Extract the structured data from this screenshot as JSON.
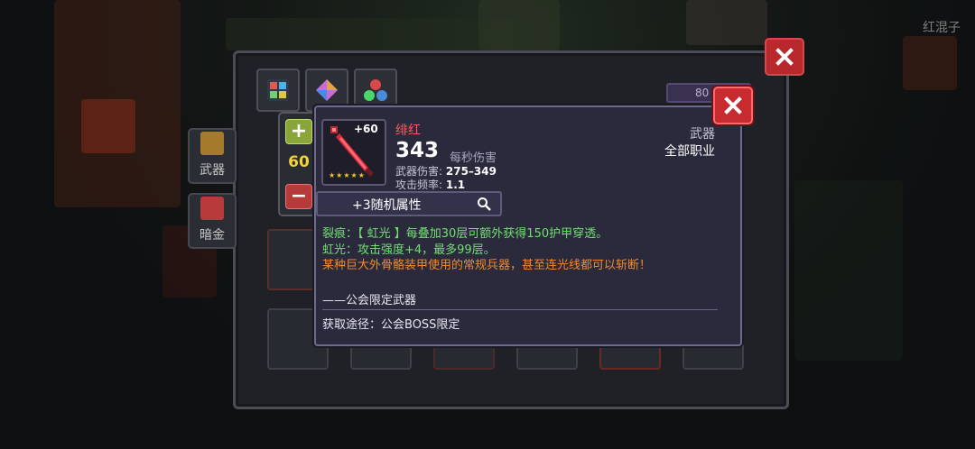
{
  "player": {
    "name": "红混子"
  },
  "inventory": {
    "side_tabs": [
      {
        "label": "武器"
      },
      {
        "label": "暗金"
      }
    ],
    "currency_value": "80"
  },
  "stepper": {
    "value": "60",
    "plus_label": "+",
    "minus_label": "−"
  },
  "tooltip": {
    "upgrade_level": "+60",
    "stars": "★★★★★",
    "name": "绯红",
    "dps_value": "343",
    "dps_label": "每秒伤害",
    "damage_label": "武器伤害:",
    "damage_value": "275–349",
    "attack_rate_label": "攻击频率:",
    "attack_rate_value": "1.1",
    "type": "武器",
    "class": "全部职业",
    "random_attr_label": "+3随机属性",
    "effects_green": [
      "裂痕：【 虹光 】每叠加30层可额外获得150护甲穿透。",
      "虹光：攻击强度+4，最多99层。"
    ],
    "description": "某种巨大外骨骼装甲使用的常规兵器，甚至连光线都可以斩断！",
    "motto": "——公会限定武器",
    "source": "获取途径：公会BOSS限定"
  },
  "colors": {
    "weapon_name": "#ff5a5a",
    "effect_green": "#6fe06f",
    "description_orange": "#f08a2a",
    "close_button": "#c72a2f"
  }
}
